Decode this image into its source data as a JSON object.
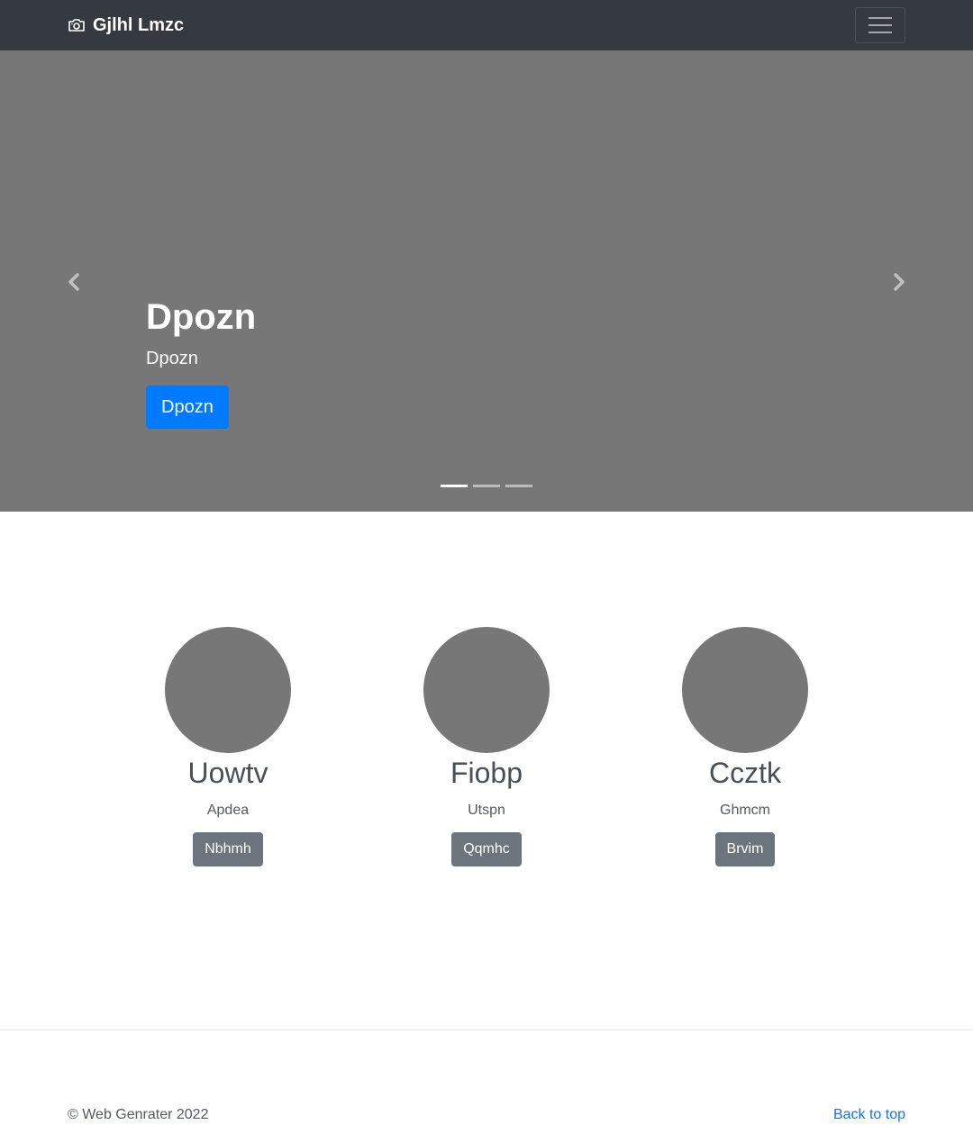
{
  "navbar": {
    "brand_icon": "camera-icon",
    "brand_name": "Gjlhl Lmzc",
    "toggler_icon": "hamburger-menu-icon"
  },
  "carousel": {
    "prev_icon": "chevron-left-icon",
    "next_icon": "chevron-right-icon",
    "heading": "Dpozn",
    "text": "Dpozn",
    "button": "Dpozn",
    "slide_count": 3,
    "active_index": 0
  },
  "features": [
    {
      "title": "Uowtv",
      "subtitle": "Apdea",
      "button": "Nbhmh"
    },
    {
      "title": "Fiobp",
      "subtitle": "Utspn",
      "button": "Qqmhc"
    },
    {
      "title": "Ccztk",
      "subtitle": "Ghmcm",
      "button": "Brvim"
    }
  ],
  "footer": {
    "copyright": "© Web Genrater 2022",
    "back_to_top": "Back to top"
  },
  "colors": {
    "navbar_bg": "#343a40",
    "carousel_bg": "#777777",
    "primary": "#007bff",
    "secondary": "#6c757d",
    "link": "#1a73d6"
  }
}
